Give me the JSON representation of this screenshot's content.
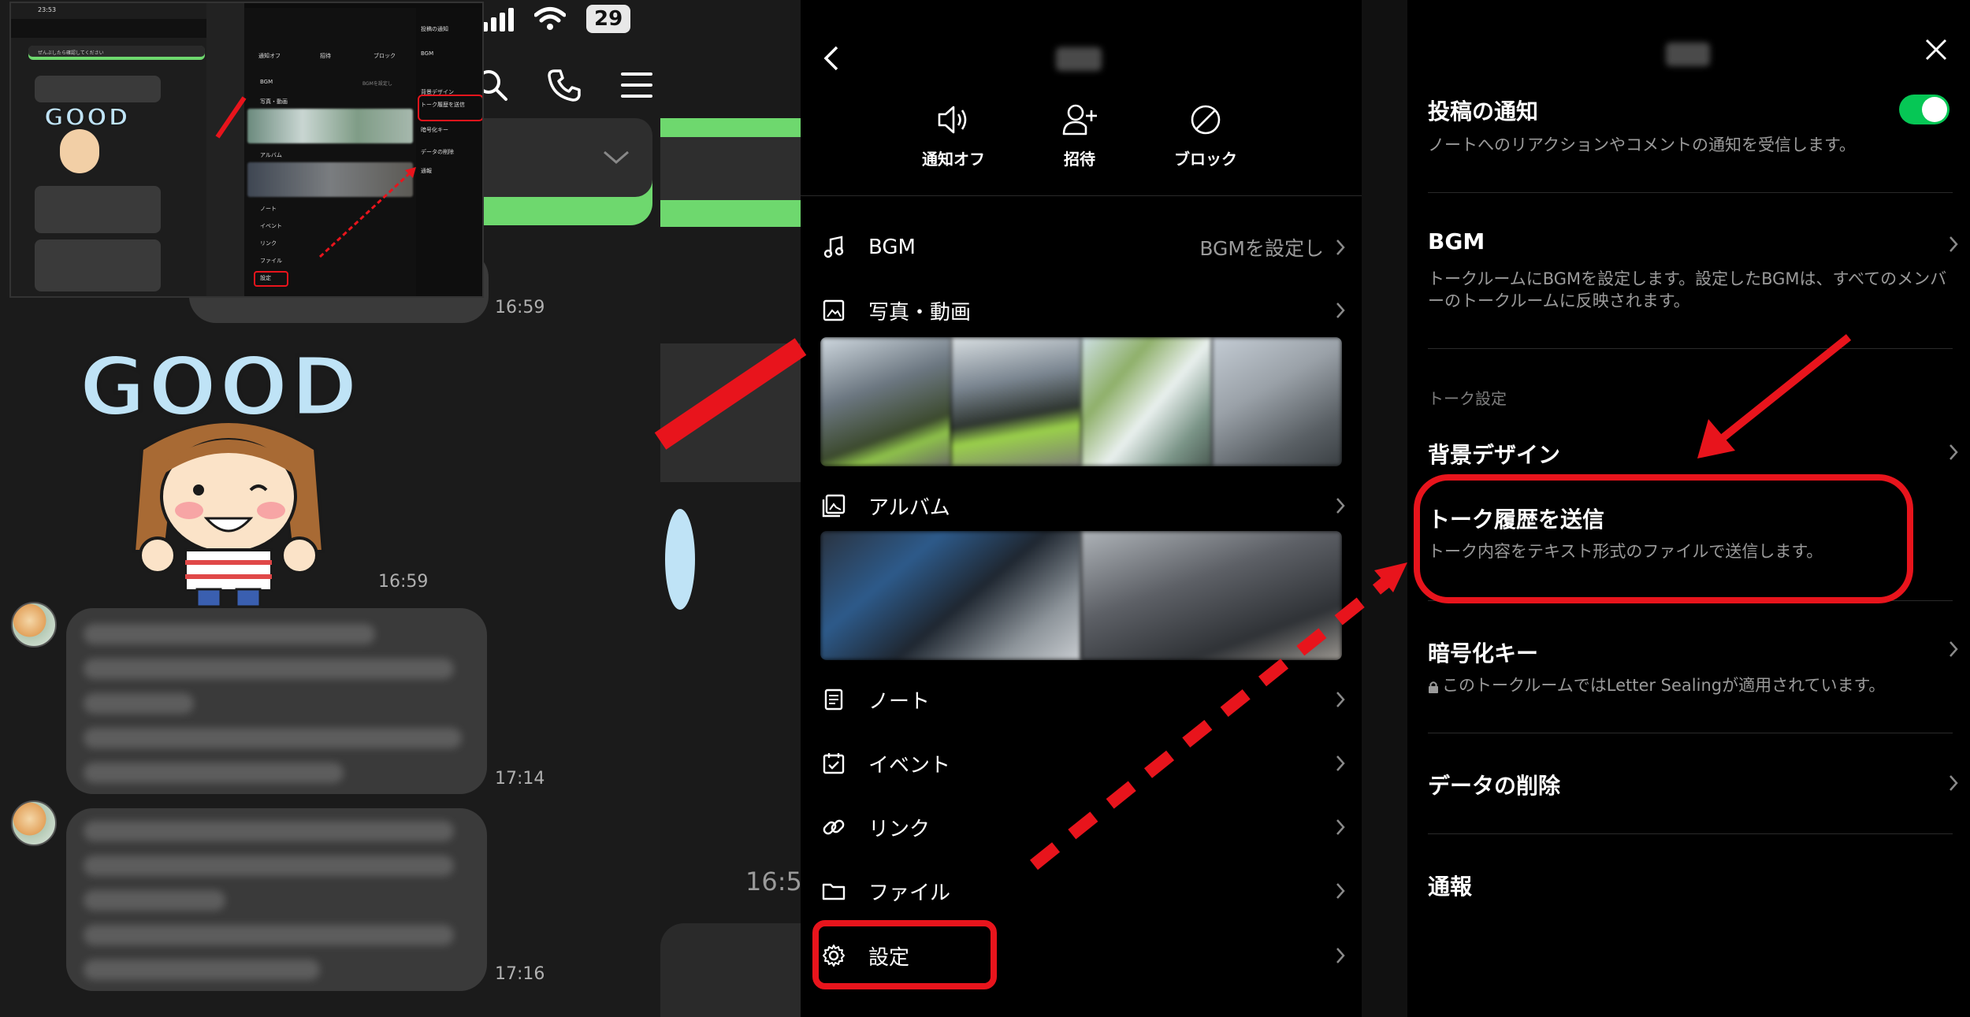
{
  "chat": {
    "battery": "29",
    "times": [
      "16:59",
      "16:59",
      "17:14",
      "17:16"
    ],
    "sticker_text": "GOOD",
    "gap_time": "16:5",
    "inset": {
      "status_time": "23:53",
      "bubble_top": "ぜんぶしたら確認してください",
      "sticker_text": "GOOD",
      "menu_actions": [
        "通知オフ",
        "招待",
        "ブロック"
      ],
      "menu_items": [
        "BGM",
        "写真・動画",
        "アルバム",
        "ノート",
        "イベント",
        "リンク",
        "ファイル",
        "設定"
      ],
      "menu_bgm_value": "BGMを設定し",
      "settings_items": [
        "投稿の通知",
        "BGM",
        "背景デザイン",
        "トーク履歴を送信",
        "暗号化キー",
        "データの削除",
        "通報"
      ]
    }
  },
  "menu": {
    "actions": [
      {
        "label": "通知オフ",
        "icon": "speaker-icon"
      },
      {
        "label": "招待",
        "icon": "add-person-icon"
      },
      {
        "label": "ブロック",
        "icon": "block-icon"
      }
    ],
    "items": {
      "bgm": {
        "label": "BGM",
        "value": "BGMを設定し"
      },
      "photos": {
        "label": "写真・動画"
      },
      "album": {
        "label": "アルバム"
      },
      "note": {
        "label": "ノート"
      },
      "event": {
        "label": "イベント"
      },
      "link": {
        "label": "リンク"
      },
      "file": {
        "label": "ファイル"
      },
      "settings": {
        "label": "設定"
      }
    }
  },
  "settings": {
    "post_notify": {
      "title": "投稿の通知",
      "desc": "ノートへのリアクションやコメントの通知を受信します。",
      "enabled": true
    },
    "bgm": {
      "title": "BGM",
      "desc": "トークルームにBGMを設定します。設定したBGMは、すべてのメンバーのトークルームに反映されます。"
    },
    "section_label": "トーク設定",
    "background": {
      "title": "背景デザイン"
    },
    "send_history": {
      "title": "トーク履歴を送信",
      "desc": "トーク内容をテキスト形式のファイルで送信します。"
    },
    "encryption": {
      "title": "暗号化キー",
      "desc": "このトークルームではLetter Sealingが適用されています。"
    },
    "delete_data": {
      "title": "データの削除"
    },
    "report": {
      "title": "通報"
    }
  },
  "colors": {
    "annotation_red": "#e8141c",
    "line_green": "#06c755",
    "chat_green": "#6ed86e"
  }
}
